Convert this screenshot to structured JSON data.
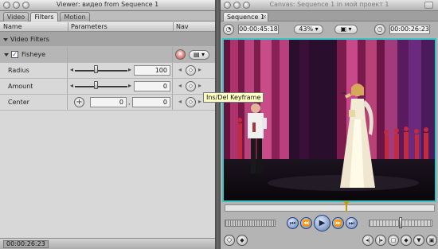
{
  "viewer": {
    "title": "Viewer: видео from Sequence 1",
    "tabs": [
      {
        "label": "Video"
      },
      {
        "label": "Filters"
      },
      {
        "label": "Motion"
      }
    ],
    "columns": {
      "name": "Name",
      "parameters": "Parameters",
      "nav": "Nav"
    },
    "section": "Video Filters",
    "filter": {
      "name": "Fisheye",
      "enabled": true
    },
    "params": [
      {
        "label": "Radius",
        "value": "100",
        "slider_fraction": 0.4
      },
      {
        "label": "Amount",
        "value": "0",
        "slider_fraction": 0.4
      },
      {
        "label": "Center",
        "x": "0",
        "y": "0",
        "sep": ","
      }
    ],
    "tooltip": "Ins/Del Keyframe",
    "timecode": "00:00:26:23"
  },
  "canvas": {
    "title": "Canvas: Sequence 1 in мой проект 1",
    "tab": "Sequence 1",
    "duration": "00:00:45:18",
    "zoom": "43%",
    "timecode": "00:00:26:23",
    "playhead_fraction": 0.58
  },
  "colors": {
    "selection_border": "#32c6c6",
    "transport_blue": "#5e79ad",
    "playhead": "#c49a00",
    "tooltip_bg": "#ffffc5"
  }
}
